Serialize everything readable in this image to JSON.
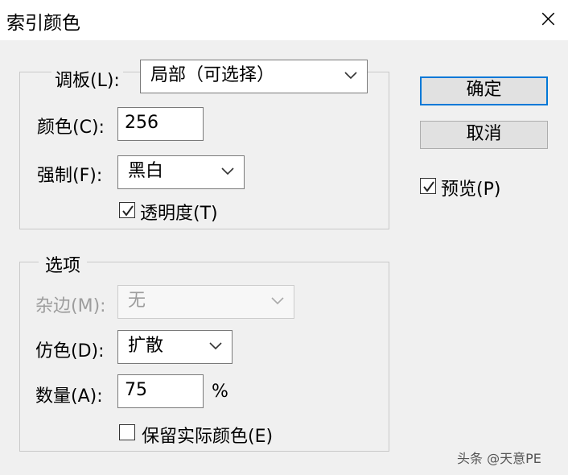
{
  "window": {
    "title": "索引颜色",
    "close_icon": "×"
  },
  "palette_group": {
    "palette_label": "调板(L):",
    "palette_value": "局部（可选择）",
    "colors_label": "颜色(C):",
    "colors_value": "256",
    "forced_label": "强制(F):",
    "forced_value": "黑白",
    "transparency_label": "透明度(T)",
    "transparency_checked": true
  },
  "options_group": {
    "legend": "选项",
    "matte_label": "杂边(M):",
    "matte_value": "无",
    "dither_label": "仿色(D):",
    "dither_value": "扩散",
    "amount_label": "数量(A):",
    "amount_value": "75",
    "amount_unit": "%",
    "preserve_label": "保留实际颜色(E)",
    "preserve_checked": false
  },
  "buttons": {
    "ok": "确定",
    "cancel": "取消"
  },
  "preview": {
    "label": "预览(P)",
    "checked": true
  },
  "watermark": "头条 @天意PE",
  "colors": {
    "accent": "#0078d7",
    "disabled_text": "#9d9d9d"
  }
}
